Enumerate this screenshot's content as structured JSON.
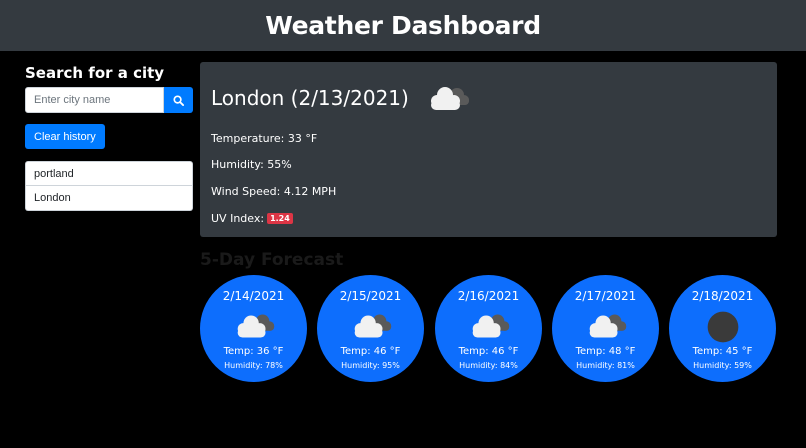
{
  "header": {
    "title": "Weather Dashboard"
  },
  "sidebar": {
    "heading": "Search for a city",
    "search_placeholder": "Enter city name",
    "clear_label": "Clear history",
    "history": [
      "portland",
      "London"
    ]
  },
  "current": {
    "title": "London (2/13/2021)",
    "icon": "clouds-icon",
    "temperature": "Temperature: 33 °F",
    "humidity": "Humidity: 55%",
    "wind": "Wind Speed: 4.12 MPH",
    "uv_label": "UV Index:",
    "uv_value": "1.24",
    "uv_color": "#dc3545"
  },
  "forecast": {
    "title": "5-Day Forecast",
    "days": [
      {
        "date": "2/14/2021",
        "icon": "clouds-icon",
        "temp": "Temp: 36 °F",
        "humidity": "Humidity: 78%"
      },
      {
        "date": "2/15/2021",
        "icon": "clouds-icon",
        "temp": "Temp: 46 °F",
        "humidity": "Humidity: 95%"
      },
      {
        "date": "2/16/2021",
        "icon": "clouds-icon",
        "temp": "Temp: 46 °F",
        "humidity": "Humidity: 84%"
      },
      {
        "date": "2/17/2021",
        "icon": "clouds-icon",
        "temp": "Temp: 48 °F",
        "humidity": "Humidity: 81%"
      },
      {
        "date": "2/18/2021",
        "icon": "overcast-icon",
        "temp": "Temp: 45 °F",
        "humidity": "Humidity: 59%"
      }
    ]
  },
  "colors": {
    "header_bg": "#343a40",
    "accent": "#007bff",
    "card_bg": "#0d6efd",
    "page_bg": "#000000"
  }
}
